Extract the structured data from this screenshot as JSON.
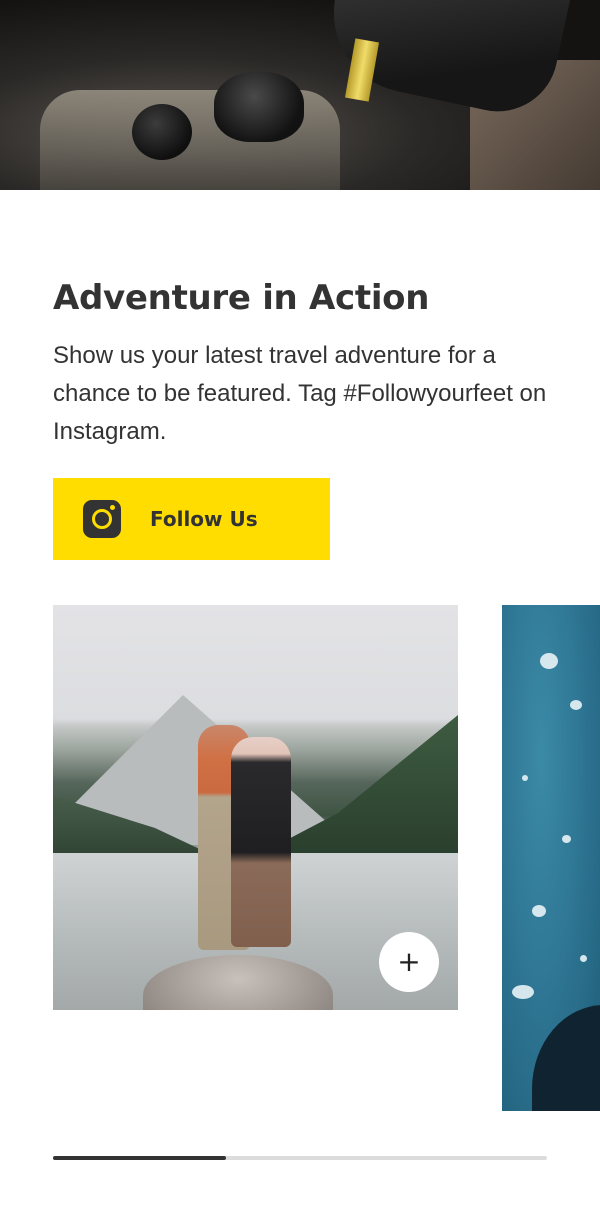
{
  "section": {
    "title": "Adventure in Action",
    "description": "Show us your latest travel adventure for a chance to be featured. Tag #Followyourfeet on Instagram."
  },
  "follow_button": {
    "label": "Follow Us",
    "icon": "instagram-icon"
  },
  "gallery": {
    "add_button_label": "+",
    "progress": 0.35
  },
  "colors": {
    "accent": "#ffdd00",
    "text": "#333333",
    "track": "#dcdcdc"
  }
}
